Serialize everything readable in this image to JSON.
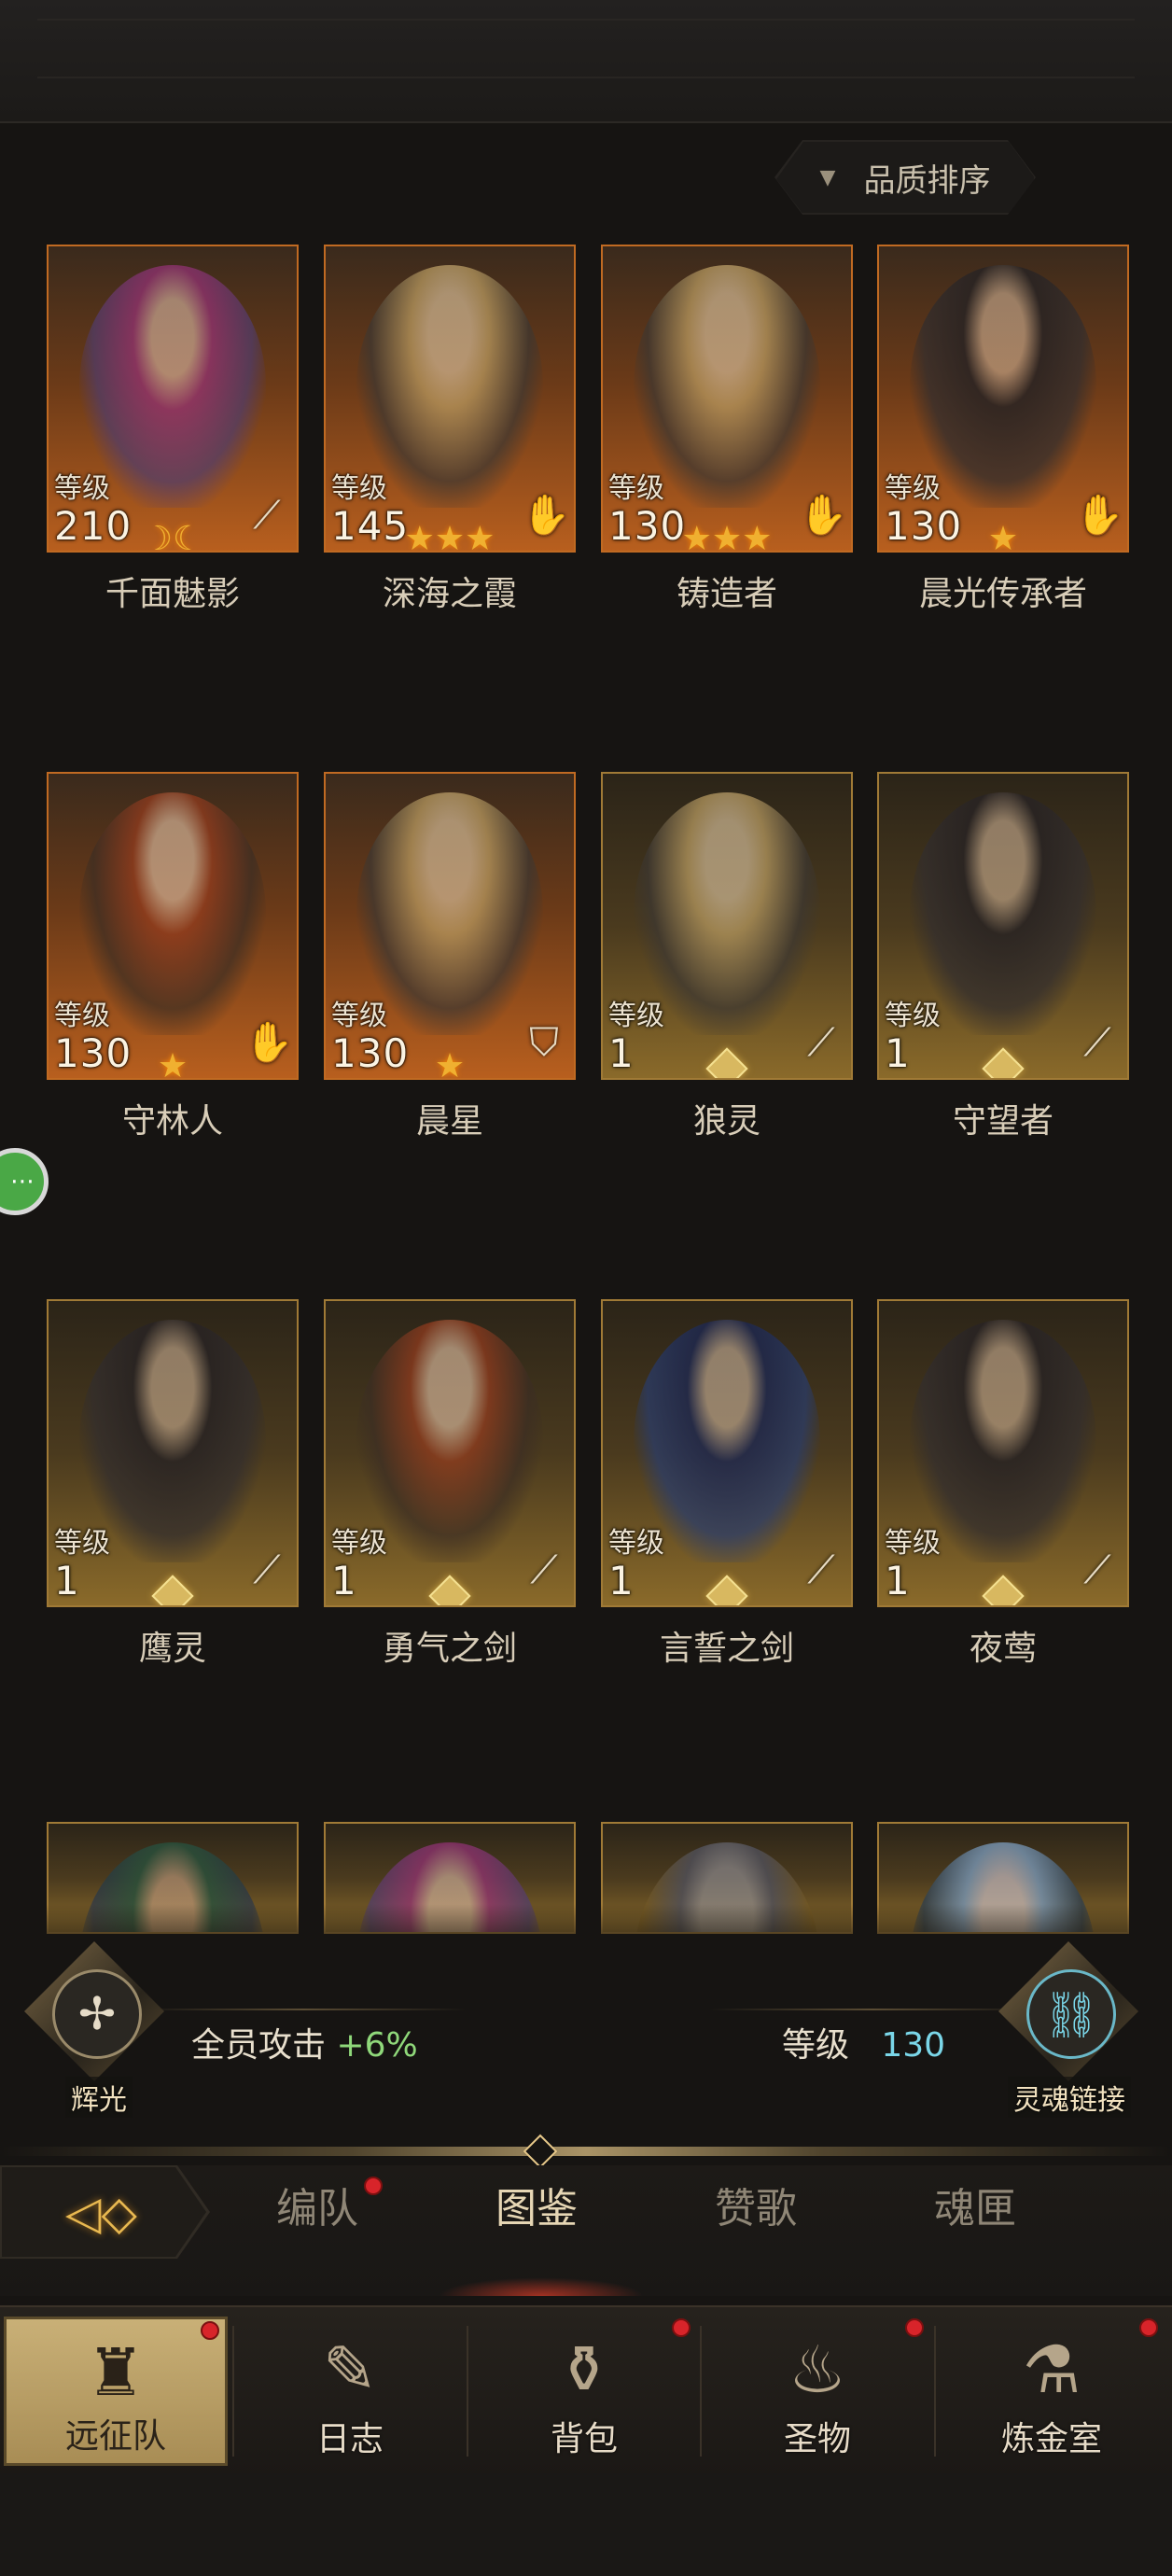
{
  "sort": {
    "label": "品质排序"
  },
  "heroes": [
    {
      "name": "千面魅影",
      "level_label": "等级",
      "level": "210",
      "rank": "moon",
      "class_icon": "sword-icon",
      "frame": "orange",
      "portrait": "hair-purple"
    },
    {
      "name": "深海之霞",
      "level_label": "等级",
      "level": "145",
      "rank": "3-star",
      "class_icon": "hand-icon",
      "frame": "orange",
      "portrait": "hair-blond"
    },
    {
      "name": "铸造者",
      "level_label": "等级",
      "level": "130",
      "rank": "3-star",
      "class_icon": "hand-icon",
      "frame": "orange",
      "portrait": "hair-blond"
    },
    {
      "name": "晨光传承者",
      "level_label": "等级",
      "level": "130",
      "rank": "1-star",
      "class_icon": "hand-icon",
      "frame": "orange",
      "portrait": "hair-dark"
    },
    {
      "name": "守林人",
      "level_label": "等级",
      "level": "130",
      "rank": "1-star",
      "class_icon": "hand-icon",
      "frame": "orange",
      "portrait": "hair-red"
    },
    {
      "name": "晨星",
      "level_label": "等级",
      "level": "130",
      "rank": "1-star",
      "class_icon": "shield-icon",
      "frame": "orange",
      "portrait": "hair-blond"
    },
    {
      "name": "狼灵",
      "level_label": "等级",
      "level": "1",
      "rank": "gem",
      "class_icon": "sword-icon",
      "frame": "gold",
      "portrait": "hair-blond"
    },
    {
      "name": "守望者",
      "level_label": "等级",
      "level": "1",
      "rank": "gem",
      "class_icon": "sword-icon",
      "frame": "gold",
      "portrait": "hair-dark"
    },
    {
      "name": "鹰灵",
      "level_label": "等级",
      "level": "1",
      "rank": "gem",
      "class_icon": "sword-icon",
      "frame": "gold",
      "portrait": "hair-dark"
    },
    {
      "name": "勇气之剑",
      "level_label": "等级",
      "level": "1",
      "rank": "gem",
      "class_icon": "sword-icon",
      "frame": "gold",
      "portrait": "hair-red"
    },
    {
      "name": "言誓之剑",
      "level_label": "等级",
      "level": "1",
      "rank": "gem",
      "class_icon": "sword-icon",
      "frame": "gold",
      "portrait": "hair-blue"
    },
    {
      "name": "夜莺",
      "level_label": "等级",
      "level": "1",
      "rank": "gem",
      "class_icon": "sword-icon",
      "frame": "gold",
      "portrait": "hair-dark"
    },
    {
      "name": "",
      "level_label": "",
      "level": "",
      "rank": "",
      "class_icon": "",
      "frame": "gold",
      "portrait": "hair-green"
    },
    {
      "name": "",
      "level_label": "",
      "level": "",
      "rank": "",
      "class_icon": "",
      "frame": "gold",
      "portrait": "hair-purple"
    },
    {
      "name": "",
      "level_label": "",
      "level": "",
      "rank": "",
      "class_icon": "",
      "frame": "gold",
      "portrait": "hair-wolf"
    },
    {
      "name": "",
      "level_label": "",
      "level": "",
      "rank": "",
      "class_icon": "",
      "frame": "gold",
      "portrait": "hair-elf"
    }
  ],
  "bonus": {
    "left_emblem": "辉光",
    "left_text": "全员攻击",
    "left_value": "+6%",
    "right_label": "等级",
    "right_value": "130",
    "right_emblem": "灵魂链接"
  },
  "tabs": [
    {
      "label": "编队",
      "active": false,
      "dot": true
    },
    {
      "label": "图鉴",
      "active": true,
      "dot": false
    },
    {
      "label": "赞歌",
      "active": false,
      "dot": false
    },
    {
      "label": "魂匣",
      "active": false,
      "dot": false
    }
  ],
  "nav": [
    {
      "label": "远征队",
      "icon": "helmet-icon",
      "active": true,
      "dot": true
    },
    {
      "label": "日志",
      "icon": "scroll-icon",
      "active": false,
      "dot": false
    },
    {
      "label": "背包",
      "icon": "bag-icon",
      "active": false,
      "dot": true
    },
    {
      "label": "圣物",
      "icon": "torch-icon",
      "active": false,
      "dot": true
    },
    {
      "label": "炼金室",
      "icon": "alchemy-icon",
      "active": false,
      "dot": true
    }
  ],
  "colors": {
    "accent": "#e8b850",
    "level_cyan": "#7ad6e8",
    "bonus_green": "#8fd87a",
    "notify_red": "#d8242a"
  }
}
